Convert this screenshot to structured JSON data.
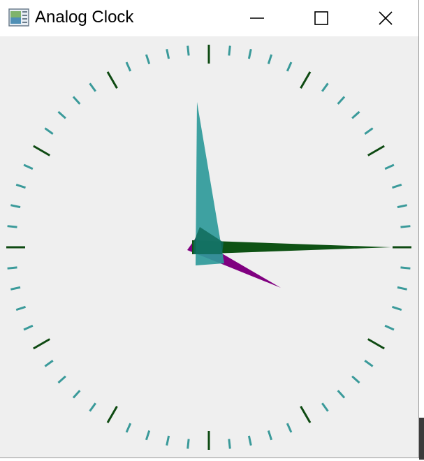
{
  "window": {
    "title": "Analog Clock",
    "app_icon": "app-window-icon",
    "controls": {
      "minimize_icon": "minimize-icon",
      "maximize_icon": "maximize-icon",
      "close_icon": "close-icon"
    }
  },
  "clock": {
    "time": {
      "hours": 3,
      "minutes": 15,
      "seconds": 0
    },
    "ticks": {
      "count": 60,
      "major_every": 5,
      "major_color": "#0e4a12",
      "minor_color": "#3a9a9a"
    },
    "hands": {
      "hour": {
        "color": "#800080"
      },
      "minute": {
        "color": "#0e5214"
      },
      "second": {
        "color": "#2f9a9a"
      },
      "overlap_color": "#0f6b5a"
    },
    "face_color": "#efefef"
  }
}
